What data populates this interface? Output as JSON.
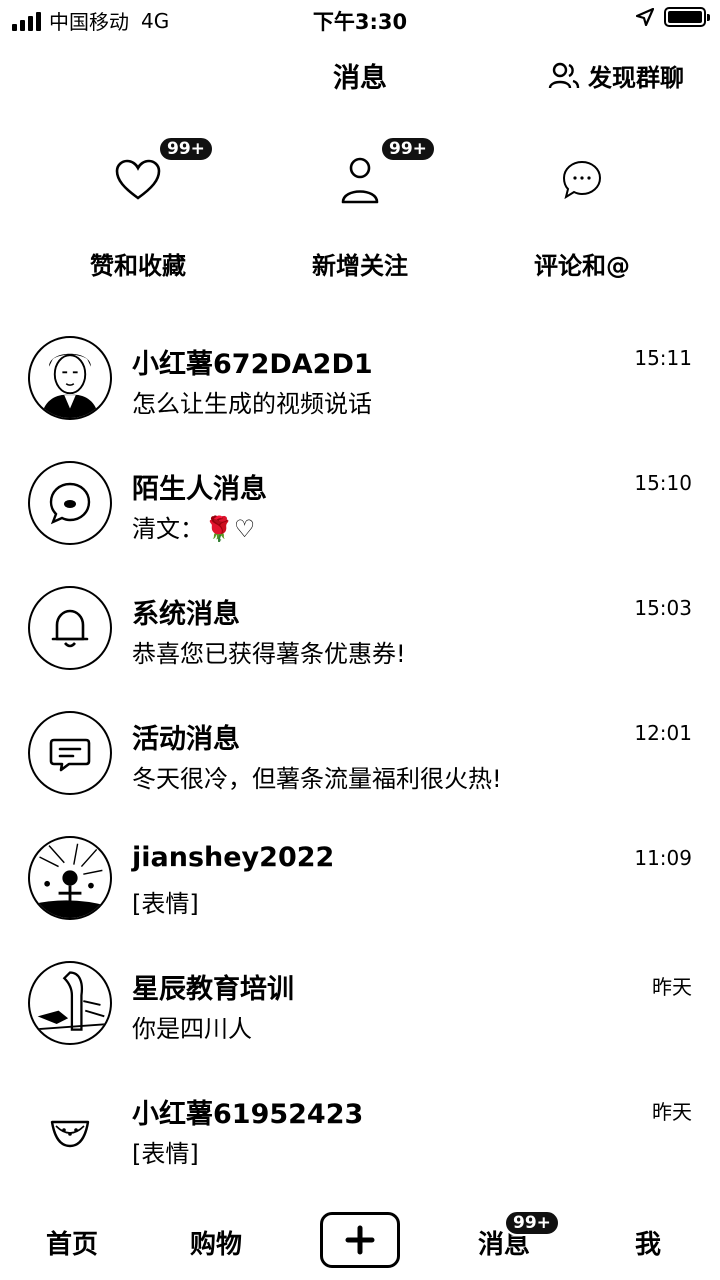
{
  "status_bar": {
    "carrier": "中国移动",
    "network": "4G",
    "time": "下午3:30"
  },
  "header": {
    "title": "消息",
    "discover_label": "发现群聊"
  },
  "quick": [
    {
      "label": "赞和收藏",
      "badge": "99+",
      "icon": "heart-icon"
    },
    {
      "label": "新增关注",
      "badge": "99+",
      "icon": "person-icon"
    },
    {
      "label": "评论和@",
      "badge": "",
      "icon": "comment-icon"
    }
  ],
  "messages": [
    {
      "title": "小红薯672DA2D1",
      "subtitle": "怎么让生成的视频说话",
      "time": "15:11",
      "avatar": "user-photo-avatar"
    },
    {
      "title": "陌生人消息",
      "subtitle": "清文：🌹♡",
      "time": "15:10",
      "avatar": "stranger-chat-icon"
    },
    {
      "title": "系统消息",
      "subtitle": "恭喜您已获得薯条优惠券!",
      "time": "15:03",
      "avatar": "bell-icon"
    },
    {
      "title": "活动消息",
      "subtitle": "冬天很冷，但薯条流量福利很火热!",
      "time": "12:01",
      "avatar": "activity-message-icon"
    },
    {
      "title": "jianshey2022",
      "subtitle": "[表情]",
      "time": "11:09",
      "avatar": "user-photo-avatar"
    },
    {
      "title": "星辰教育培训",
      "subtitle": "你是四川人",
      "time": "昨天",
      "avatar": "user-photo-avatar"
    },
    {
      "title": "小红薯61952423",
      "subtitle": "[表情]",
      "time": "昨天",
      "avatar": "watermelon-icon"
    }
  ],
  "tabbar": {
    "home": "首页",
    "shop": "购物",
    "messages": "消息",
    "messages_badge": "99+",
    "me": "我"
  }
}
